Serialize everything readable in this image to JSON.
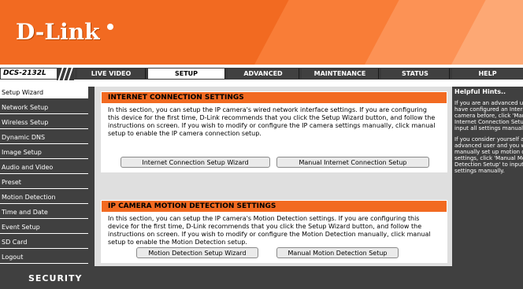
{
  "header": {
    "logo_text": "D-Link"
  },
  "nav": {
    "model": "DCS-2132L",
    "tabs": [
      {
        "label": "LIVE VIDEO"
      },
      {
        "label": "SETUP"
      },
      {
        "label": "ADVANCED"
      },
      {
        "label": "MAINTENANCE"
      },
      {
        "label": "STATUS"
      },
      {
        "label": "HELP"
      }
    ],
    "active_tab": "SETUP"
  },
  "sidebar": {
    "items": [
      {
        "label": "Setup Wizard"
      },
      {
        "label": "Network Setup"
      },
      {
        "label": "Wireless Setup"
      },
      {
        "label": "Dynamic DNS"
      },
      {
        "label": "Image Setup"
      },
      {
        "label": "Audio and Video"
      },
      {
        "label": "Preset"
      },
      {
        "label": "Motion Detection"
      },
      {
        "label": "Time and Date"
      },
      {
        "label": "Event Setup"
      },
      {
        "label": "SD Card"
      },
      {
        "label": "Logout"
      }
    ],
    "active_item": "Setup Wizard"
  },
  "main": {
    "internet": {
      "title": "INTERNET CONNECTION SETTINGS",
      "text": "In this section, you can setup the IP camera's wired network interface settings. If you are configuring this device for the first time, D-Link recommends that you click the Setup Wizard button, and follow the instructions on screen. If you wish to modify or configure the IP camera settings manually, click manual setup to enable the IP camera connection setup.",
      "wizard_button": "Internet Connection Setup Wizard",
      "manual_button": "Manual Internet Connection Setup"
    },
    "motion": {
      "title": "IP CAMERA MOTION DETECTION SETTINGS",
      "text": "In this section, you can setup the IP camera's Motion Detection settings. If you are configuring this device for the first time, D-Link recommends that you click the Setup Wizard button, and follow the instructions on screen. If you wish to modify or configure the Motion Detection manually, click manual setup to enable the Motion Detection setup.",
      "wizard_button": "Motion Detection Setup Wizard",
      "manual_button": "Manual Motion Detection Setup"
    }
  },
  "hints": {
    "title": "Helpful Hints..",
    "paragraph1": "If you are an advanced user and have configured an Internet camera before, click 'Manual Internet Connection Setup' to input all settings manually.",
    "paragraph2": "If you consider yourself an advanced user and you want to manually set up motion detection settings, click 'Manual Motion Detection Setup' to input all the settings manually."
  },
  "footer": {
    "label": "SECURITY"
  }
}
